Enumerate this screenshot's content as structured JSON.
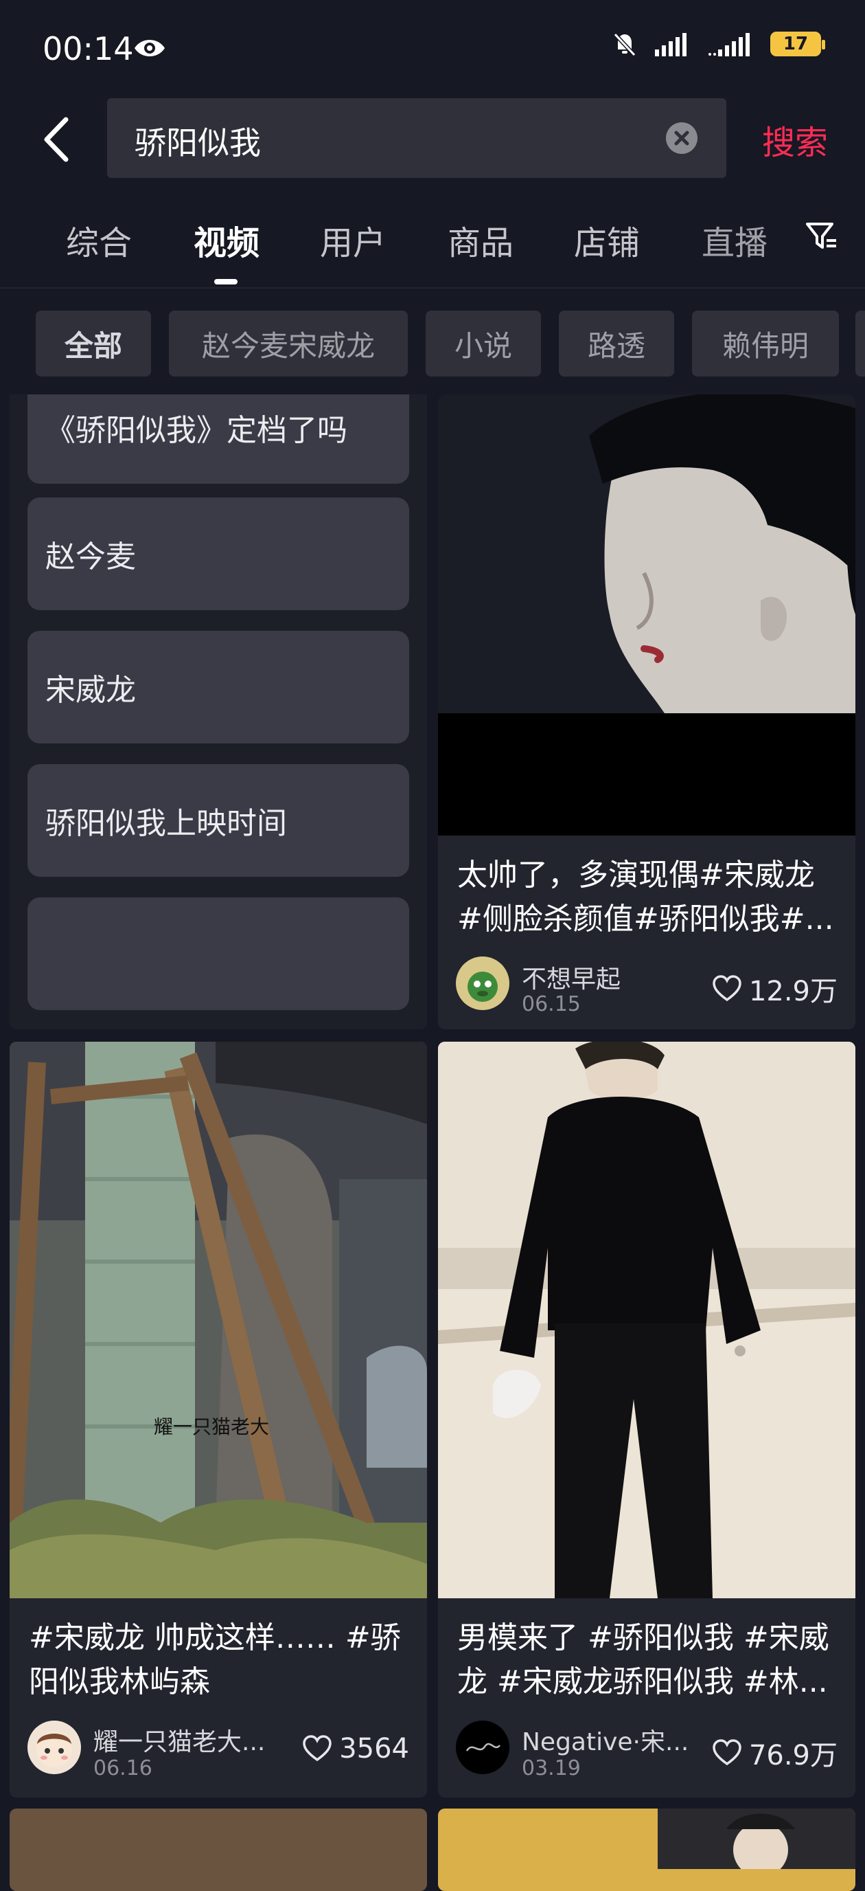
{
  "status": {
    "time": "00:14",
    "battery": "17"
  },
  "search": {
    "query": "骄阳似我",
    "button": "搜索"
  },
  "tabs": [
    "综合",
    "视频",
    "用户",
    "商品",
    "店铺",
    "直播"
  ],
  "active_tab": "视频",
  "chips": [
    "全部",
    "赵今麦宋威龙",
    "小说",
    "路透",
    "赖伟明"
  ],
  "suggestions": [
    "《骄阳似我》定档了吗",
    "赵今麦",
    "宋威龙",
    "骄阳似我上映时间",
    ""
  ],
  "videos": [
    {
      "title": "太帅了，多演现偶#宋威龙 #侧脸杀颜值#骄阳似我#...",
      "author": "不想早起",
      "date": "06.15",
      "likes": "12.9万"
    },
    {
      "title": "#宋威龙 帅成这样…… #骄阳似我林屿森",
      "author": "耀一只猫老大...",
      "date": "06.16",
      "likes": "3564",
      "watermark": "耀一只猫老大"
    },
    {
      "title": "男模来了 #骄阳似我 #宋威龙 #宋威龙骄阳似我 #林...",
      "author": "Negative·宋...",
      "date": "03.19",
      "likes": "76.9万"
    }
  ],
  "colors": {
    "accent": "#fe2c55",
    "background": "#161823",
    "battery": "#f5c542"
  }
}
